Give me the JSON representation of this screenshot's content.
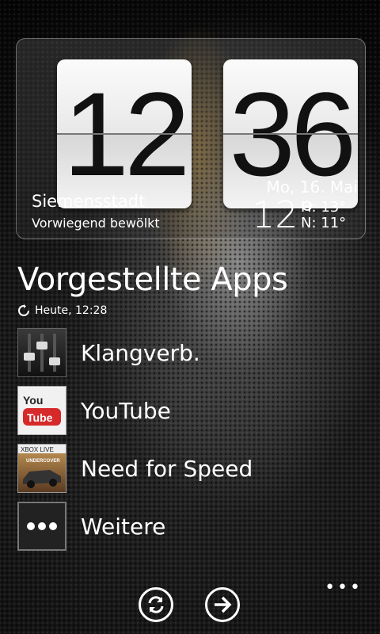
{
  "clock": {
    "hours": "12",
    "minutes": "36"
  },
  "weather": {
    "location": "Siemensstadt",
    "condition": "Vorwiegend bewölkt",
    "date": "Mo, 16. Mai",
    "temperature": "12°",
    "high": "H: 13°",
    "low": "N: 11°"
  },
  "featured": {
    "title": "Vorgestellte Apps",
    "updated": "Heute, 12:28",
    "apps": [
      {
        "label": "Klangverb.",
        "icon": "equalizer-icon"
      },
      {
        "label": "YouTube",
        "icon": "youtube-icon",
        "icon_text_1": "You",
        "icon_text_2": "Tube"
      },
      {
        "label": "Need for Speed",
        "icon": "need-for-speed-icon",
        "icon_text_1": "XBOX LIVE",
        "icon_text_2": "UNDERCOVER"
      },
      {
        "label": "Weitere",
        "icon": "more-icon"
      }
    ]
  },
  "appbar": {
    "ellipsis": "•••"
  }
}
